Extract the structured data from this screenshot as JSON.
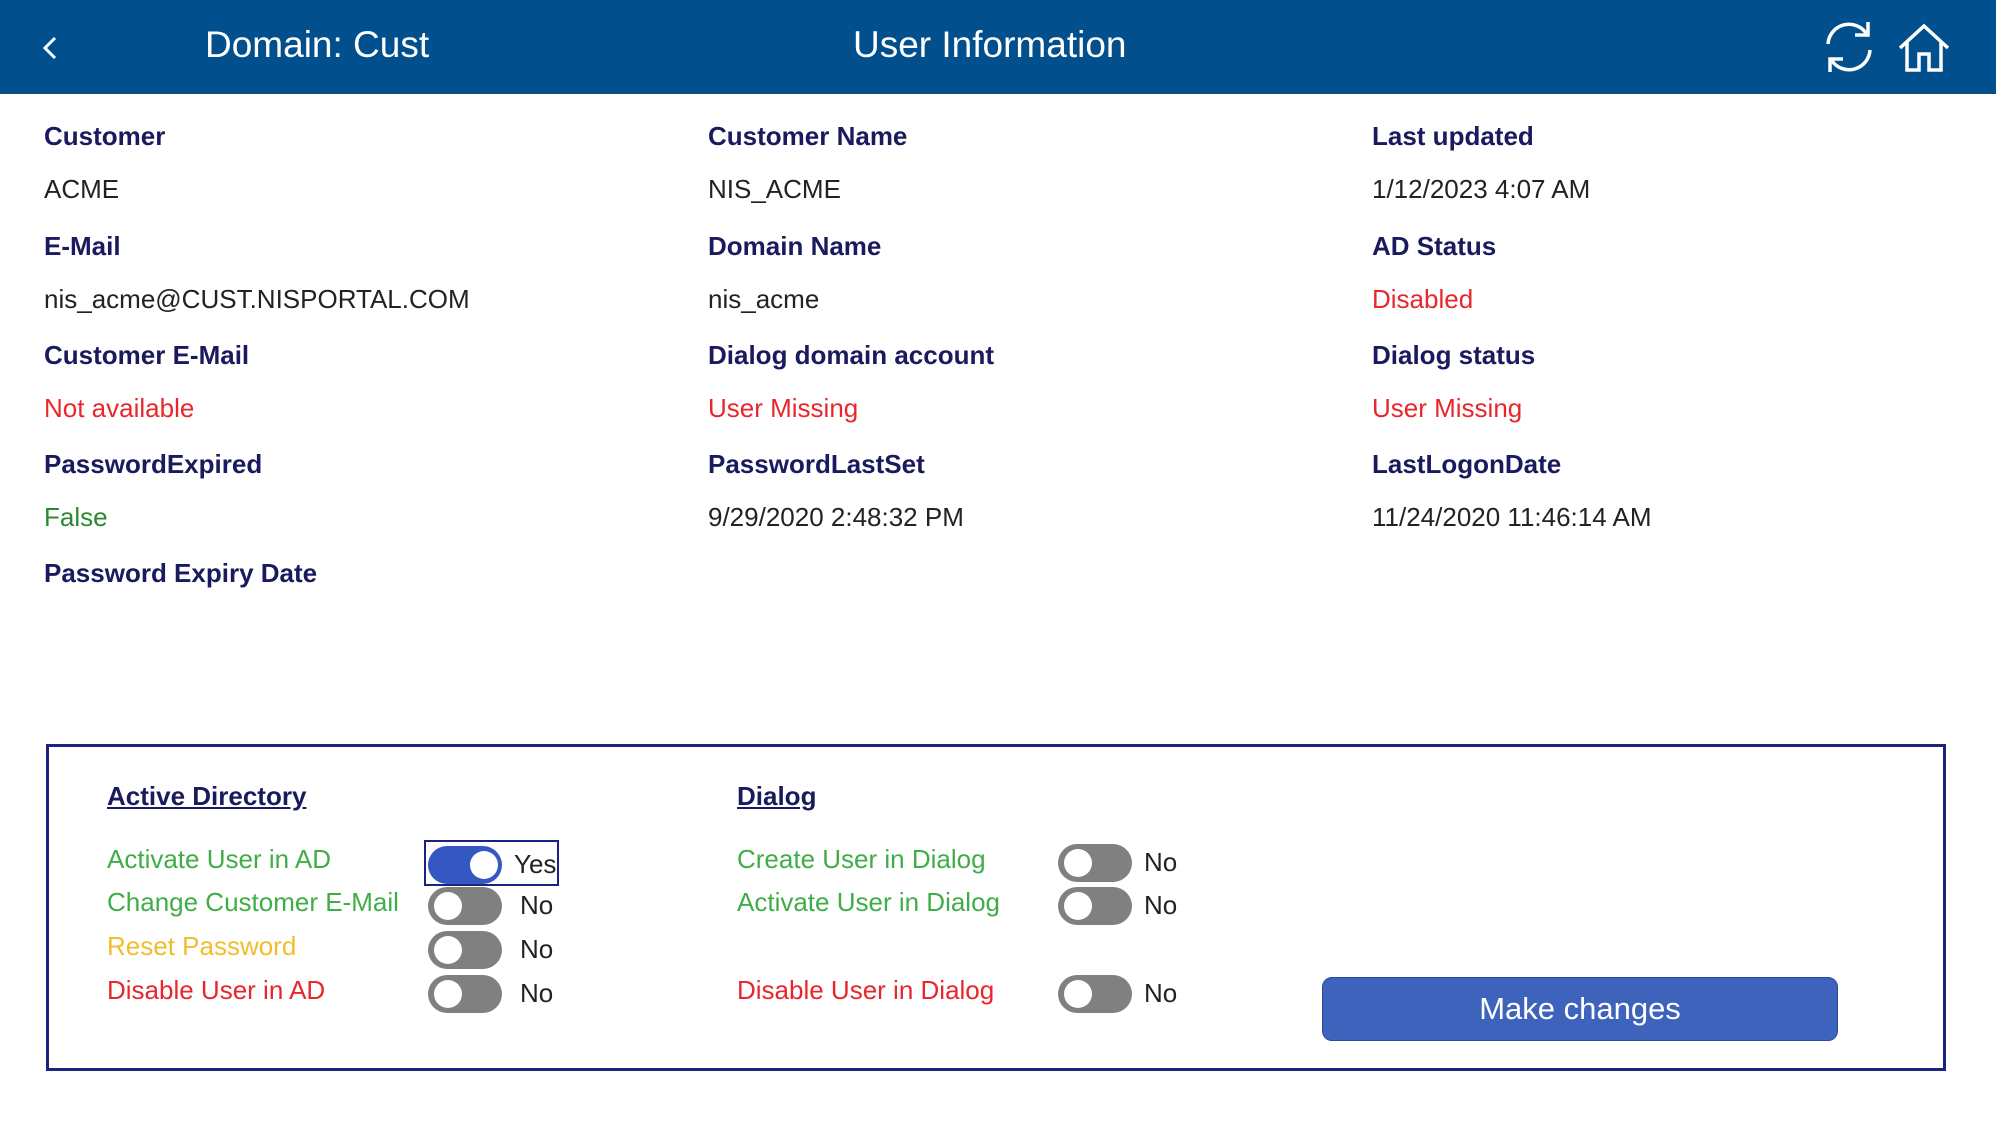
{
  "header": {
    "domain_title": "Domain: Cust",
    "page_title": "User Information",
    "background_color": "#014f8c",
    "icons": {
      "back": "chevron-left-icon",
      "refresh": "refresh-icon",
      "home": "home-icon"
    }
  },
  "fields": {
    "customer": {
      "label": "Customer",
      "value": "ACME"
    },
    "customer_name": {
      "label": "Customer Name",
      "value": "NIS_ACME"
    },
    "last_updated": {
      "label": "Last updated",
      "value": "1/12/2023 4:07 AM"
    },
    "email": {
      "label": "E-Mail",
      "value": "nis_acme@CUST.NISPORTAL.COM"
    },
    "domain_name": {
      "label": "Domain Name",
      "value": "nis_acme"
    },
    "ad_status": {
      "label": "AD Status",
      "value": "Disabled",
      "value_color": "#e8262b"
    },
    "customer_email": {
      "label": "Customer E-Mail",
      "value": "Not available",
      "value_color": "#e8262b"
    },
    "dialog_domain_account": {
      "label": "Dialog domain account",
      "value": "User Missing",
      "value_color": "#e8262b"
    },
    "dialog_status": {
      "label": "Dialog status",
      "value": "User Missing",
      "value_color": "#e8262b"
    },
    "password_expired": {
      "label": "PasswordExpired",
      "value": "False",
      "value_color": "#2b8a30"
    },
    "password_last_set": {
      "label": "PasswordLastSet",
      "value": "9/29/2020 2:48:32 PM"
    },
    "last_logon_date": {
      "label": "LastLogonDate",
      "value": "11/24/2020 11:46:14 AM"
    },
    "password_expiry_date": {
      "label": "Password Expiry Date",
      "value": ""
    }
  },
  "actions": {
    "active_directory": {
      "title": "Active Directory",
      "items": [
        {
          "label": "Activate User in AD",
          "state": "Yes",
          "on": true,
          "color": "#3fae49"
        },
        {
          "label": "Change Customer E-Mail",
          "state": "No",
          "on": false,
          "color": "#3fae49"
        },
        {
          "label": "Reset Password",
          "state": "No",
          "on": false,
          "color": "#f2bd2c"
        },
        {
          "label": "Disable User in AD",
          "state": "No",
          "on": false,
          "color": "#e8262b"
        }
      ]
    },
    "dialog": {
      "title": "Dialog",
      "items": [
        {
          "label": "Create User in Dialog",
          "state": "No",
          "on": false,
          "color": "#3fae49"
        },
        {
          "label": "Activate User in Dialog",
          "state": "No",
          "on": false,
          "color": "#3fae49"
        },
        {
          "label": "Disable User in Dialog",
          "state": "No",
          "on": false,
          "color": "#e8262b"
        }
      ]
    },
    "make_changes_label": "Make changes"
  }
}
